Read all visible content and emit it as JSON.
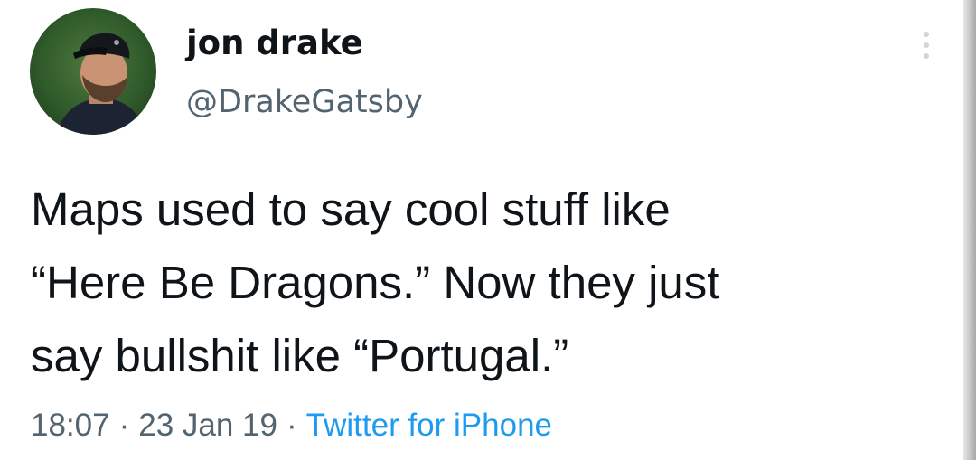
{
  "user": {
    "display_name": "jon drake",
    "handle": "@DrakeGatsby",
    "avatar_icon": "user-avatar-photo"
  },
  "tweet": {
    "lines": [
      "Maps used to say cool stuff like",
      "“Here Be Dragons.” Now they just",
      "say bullshit like “Portugal.”"
    ]
  },
  "meta": {
    "time": "18:07",
    "separator": "·",
    "date": "23 Jan 19",
    "source": "Twitter for iPhone"
  },
  "menu": {
    "icon": "more-options-icon"
  },
  "colors": {
    "text": "#0f1419",
    "secondary": "#536471",
    "link": "#1d9bf0",
    "background": "#ffffff"
  }
}
